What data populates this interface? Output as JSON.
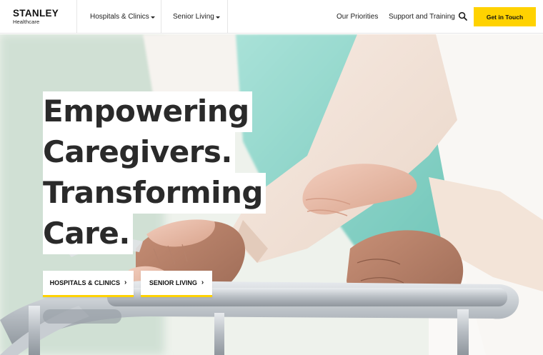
{
  "brand": {
    "name": "STANLEY",
    "sub": "Healthcare"
  },
  "nav": {
    "hospitals": "Hospitals & Clinics",
    "senior": "Senior Living",
    "priorities": "Our Priorities",
    "support": "Support and Training",
    "search_icon": "search-icon",
    "cta": "Get in Touch"
  },
  "hero": {
    "lines": [
      "Empowering",
      "Caregivers.",
      "Transforming",
      "Care."
    ],
    "buttons": [
      {
        "label": "HOSPITALS & CLINICS",
        "icon": "chevron-right-icon"
      },
      {
        "label": "SENIOR LIVING",
        "icon": "chevron-right-icon"
      }
    ],
    "image": "caregiver-assisting-senior-with-walker-photo"
  },
  "colors": {
    "accent": "#ffd200",
    "text": "#1c1c1c",
    "scrub": "#8fd9cf"
  }
}
